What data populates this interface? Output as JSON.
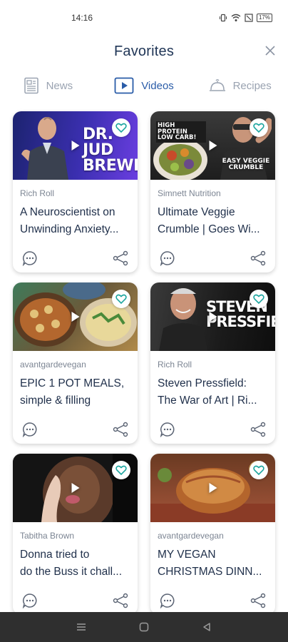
{
  "status_bar": {
    "time": "14:16",
    "battery": "17%"
  },
  "header": {
    "title": "Favorites"
  },
  "tabs": [
    {
      "label": "News",
      "icon": "newspaper-icon",
      "active": false
    },
    {
      "label": "Videos",
      "icon": "play-box-icon",
      "active": true
    },
    {
      "label": "Recipes",
      "icon": "cloche-icon",
      "active": false
    }
  ],
  "colors": {
    "accent": "#2a5ca8",
    "inactive": "#9aa3b1",
    "heart": "#1fa6a0"
  },
  "cards": [
    {
      "source": "Rich Roll",
      "title_line1": "A Neuroscientist on",
      "title_line2": "Unwinding Anxiety...",
      "thumb_text": "DR. JUD BREWER"
    },
    {
      "source": "Simnett Nutrition",
      "title_line1": "Ultimate Veggie",
      "title_line2": "Crumble | Goes Wi...",
      "thumb_text_top": "HIGH PROTEIN LOW CARB!",
      "thumb_text_bottom": "EASY VEGGIE CRUMBLE"
    },
    {
      "source": "avantgardevegan",
      "title_line1": "EPIC 1 POT MEALS,",
      "title_line2": "simple & filling"
    },
    {
      "source": "Rich Roll",
      "title_line1": "Steven Pressfield:",
      "title_line2": "The War of Art | Ri...",
      "thumb_text": "STEVEN PRESSFIELD"
    },
    {
      "source": "Tabitha Brown",
      "title_line1": "Donna tried to",
      "title_line2": "do the Buss it chall..."
    },
    {
      "source": "avantgardevegan",
      "title_line1": "MY VEGAN",
      "title_line2": "CHRISTMAS DINN..."
    }
  ]
}
